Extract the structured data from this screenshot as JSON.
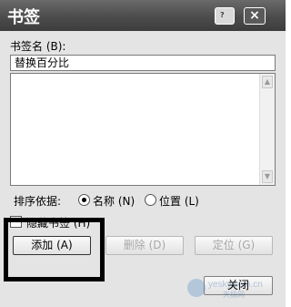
{
  "dialog": {
    "title": "书签",
    "help_icon": "help-icon",
    "close_icon": "close-icon",
    "close_glyph": "×"
  },
  "bookmark_name": {
    "label": "书签名 (B):",
    "value": "替换百分比"
  },
  "bookmark_list": {
    "items": []
  },
  "sort": {
    "label": "排序依据:",
    "options": [
      {
        "label": "名称 (N)",
        "selected": true
      },
      {
        "label": "位置 (L)",
        "selected": false
      }
    ]
  },
  "hidden_bookmarks": {
    "label": "隐藏书签 (H)",
    "checked": false
  },
  "buttons": {
    "add": "添加 (A)",
    "delete": "删除 (D)",
    "goto": "定位 (G)",
    "close": "关闭"
  },
  "watermark": {
    "text": "yesky.com.cn",
    "subtext": "天极网"
  },
  "colors": {
    "titlebar": "#4c4c4c",
    "dialog_bg": "#e4e4e4",
    "highlight_box": "#000000"
  }
}
